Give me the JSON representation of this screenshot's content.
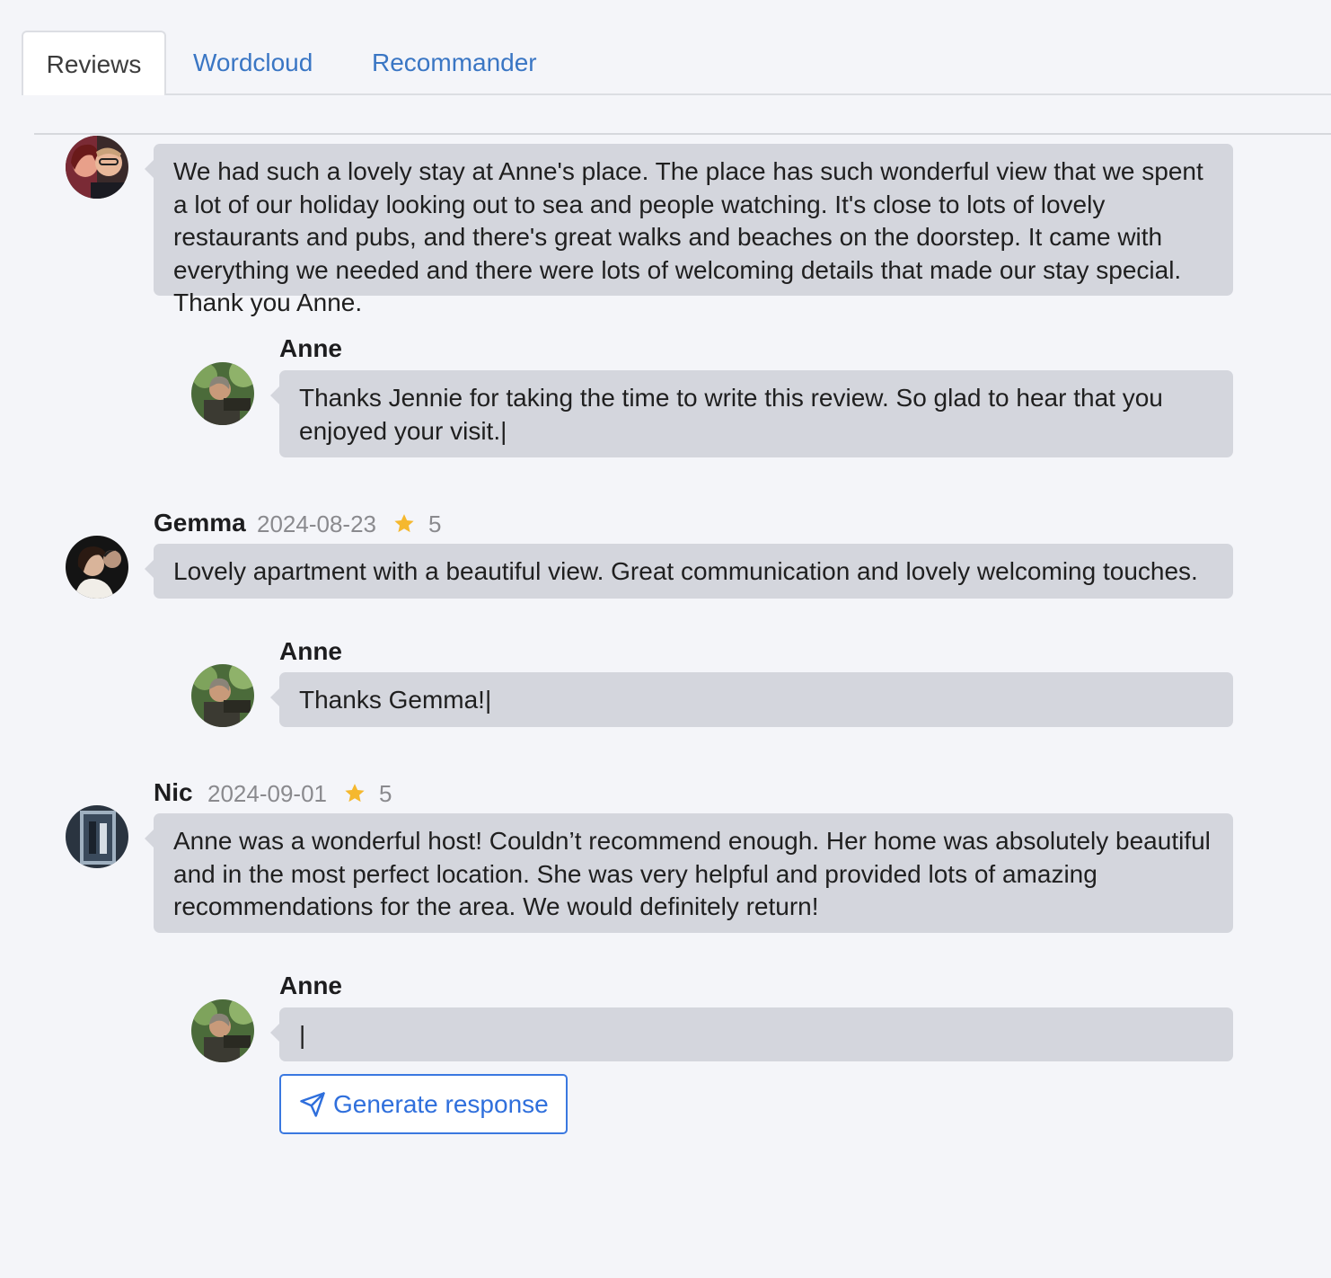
{
  "tabs": [
    {
      "label": "Reviews",
      "active": true
    },
    {
      "label": "Wordcloud",
      "active": false
    },
    {
      "label": "Recommander",
      "active": false
    }
  ],
  "reviews": [
    {
      "author": "",
      "date": "",
      "rating": "",
      "text": "We had such a lovely stay at Anne's place. The place has such wonderful view that we spent a lot of our holiday looking out to sea and people watching. It's close to lots of lovely restaurants and pubs, and there's great walks and beaches on the doorstep. It came with everything we needed and there were lots of welcoming details that made our stay special. Thank you Anne.",
      "response": {
        "author": "Anne",
        "text": "Thanks Jennie for taking the time to write this review. So glad to hear that you enjoyed your visit.|"
      }
    },
    {
      "author": "Gemma",
      "date": "2024-08-23",
      "rating": "5",
      "text": "Lovely apartment with a beautiful view. Great communication and lovely welcoming touches.",
      "response": {
        "author": "Anne",
        "text": "Thanks Gemma!|"
      }
    },
    {
      "author": "Nic",
      "date": "2024-09-01",
      "rating": "5",
      "text": "Anne was a wonderful host! Couldn’t recommend enough. Her home was absolutely beautiful and in the most perfect location. She was very helpful and provided lots of amazing recommendations for the area. We would definitely return!",
      "response": {
        "author": "Anne",
        "text": "|"
      }
    }
  ],
  "generate_button": {
    "label": "Generate response",
    "icon": "paper-plane-icon"
  },
  "colors": {
    "link": "#3a76c4",
    "bubble": "#d4d6dd",
    "star": "#f5b82e",
    "button_border": "#3a78e0",
    "background": "#f4f5f9"
  }
}
